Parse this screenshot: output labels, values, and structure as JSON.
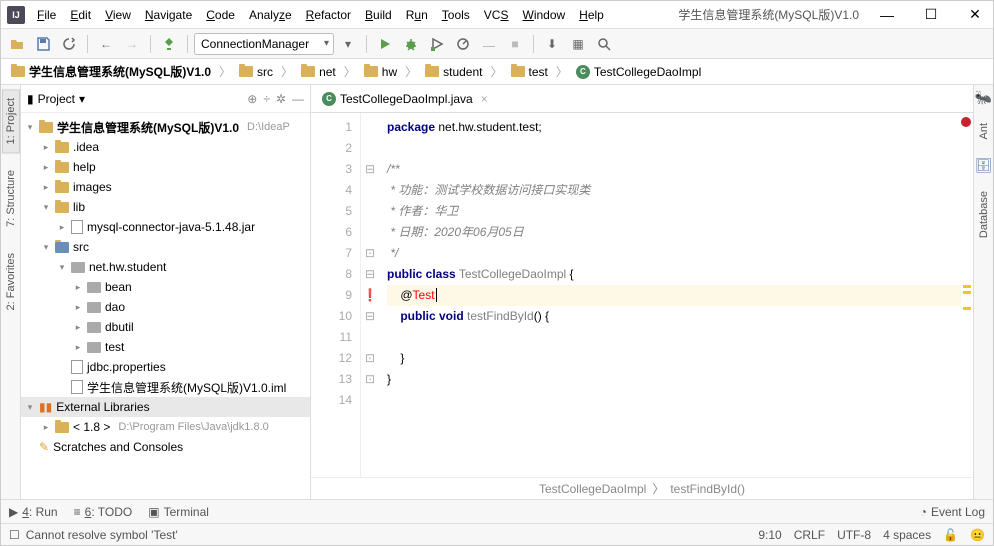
{
  "window_title": "学生信息管理系统(MySQL版)V1.0",
  "menubar": [
    "File",
    "Edit",
    "View",
    "Navigate",
    "Code",
    "Analyze",
    "Refactor",
    "Build",
    "Run",
    "Tools",
    "VCS",
    "Window",
    "Help"
  ],
  "toolbar_dropdown": "ConnectionManager",
  "breadcrumb": [
    {
      "label": "学生信息管理系统(MySQL版)V1.0",
      "icon": "folder"
    },
    {
      "label": "src",
      "icon": "folder"
    },
    {
      "label": "net",
      "icon": "folder"
    },
    {
      "label": "hw",
      "icon": "folder"
    },
    {
      "label": "student",
      "icon": "folder"
    },
    {
      "label": "test",
      "icon": "folder"
    },
    {
      "label": "TestCollegeDaoImpl",
      "icon": "class"
    }
  ],
  "project_panel_title": "Project",
  "tree": {
    "root_label": "学生信息管理系统(MySQL版)V1.0",
    "root_path": "D:\\IdeaP",
    "idea_label": ".idea",
    "help_label": "help",
    "images_label": "images",
    "lib_label": "lib",
    "jar_label": "mysql-connector-java-5.1.48.jar",
    "src_label": "src",
    "pkg_label": "net.hw.student",
    "bean_label": "bean",
    "dao_label": "dao",
    "dbutil_label": "dbutil",
    "test_label": "test",
    "props_label": "jdbc.properties",
    "iml_label": "学生信息管理系统(MySQL版)V1.0.iml",
    "ext_lib_label": "External Libraries",
    "jdk_label": "< 1.8 >",
    "jdk_path": "D:\\Program Files\\Java\\jdk1.8.0",
    "scratches_label": "Scratches and Consoles"
  },
  "editor_tab": "TestCollegeDaoImpl.java",
  "code_lines": [
    {
      "n": 1,
      "html": "<span class='kw'>package</span> net.hw.student.test;"
    },
    {
      "n": 2,
      "html": ""
    },
    {
      "n": 3,
      "html": "<span class='comment'>/**</span>"
    },
    {
      "n": 4,
      "html": "<span class='comment'> * 功能：测试学校数据访问接口实现类</span>"
    },
    {
      "n": 5,
      "html": "<span class='comment'> * 作者：华卫</span>"
    },
    {
      "n": 6,
      "html": "<span class='comment'> * 日期：2020年06月05日</span>"
    },
    {
      "n": 7,
      "html": "<span class='comment'> */</span>"
    },
    {
      "n": 8,
      "html": "<span class='kw'>public class</span> <span class='method-name'>TestCollegeDaoImpl</span> {"
    },
    {
      "n": 9,
      "html": "    @<span class='err'>Test</span><span style='border-left:1px solid #000;margin-left:1px;'>&nbsp;</span>",
      "highlighted": true,
      "err": true
    },
    {
      "n": 10,
      "html": "    <span class='kw'>public void</span> <span class='method-name'>testFindById</span>() {"
    },
    {
      "n": 11,
      "html": ""
    },
    {
      "n": 12,
      "html": "    }"
    },
    {
      "n": 13,
      "html": "}"
    },
    {
      "n": 14,
      "html": ""
    }
  ],
  "editor_breadcrumb": [
    "TestCollegeDaoImpl",
    "testFindById()"
  ],
  "left_tabs": [
    "1: Project",
    "7: Structure",
    "2: Favorites"
  ],
  "right_tabs": [
    "Ant",
    "Database"
  ],
  "bottom_tabs": [
    "4: Run",
    "6: TODO",
    "Terminal"
  ],
  "event_log": "Event Log",
  "status_message": "Cannot resolve symbol 'Test'",
  "status_right": {
    "pos": "9:10",
    "eol": "CRLF",
    "enc": "UTF-8",
    "indent": "4 spaces"
  }
}
